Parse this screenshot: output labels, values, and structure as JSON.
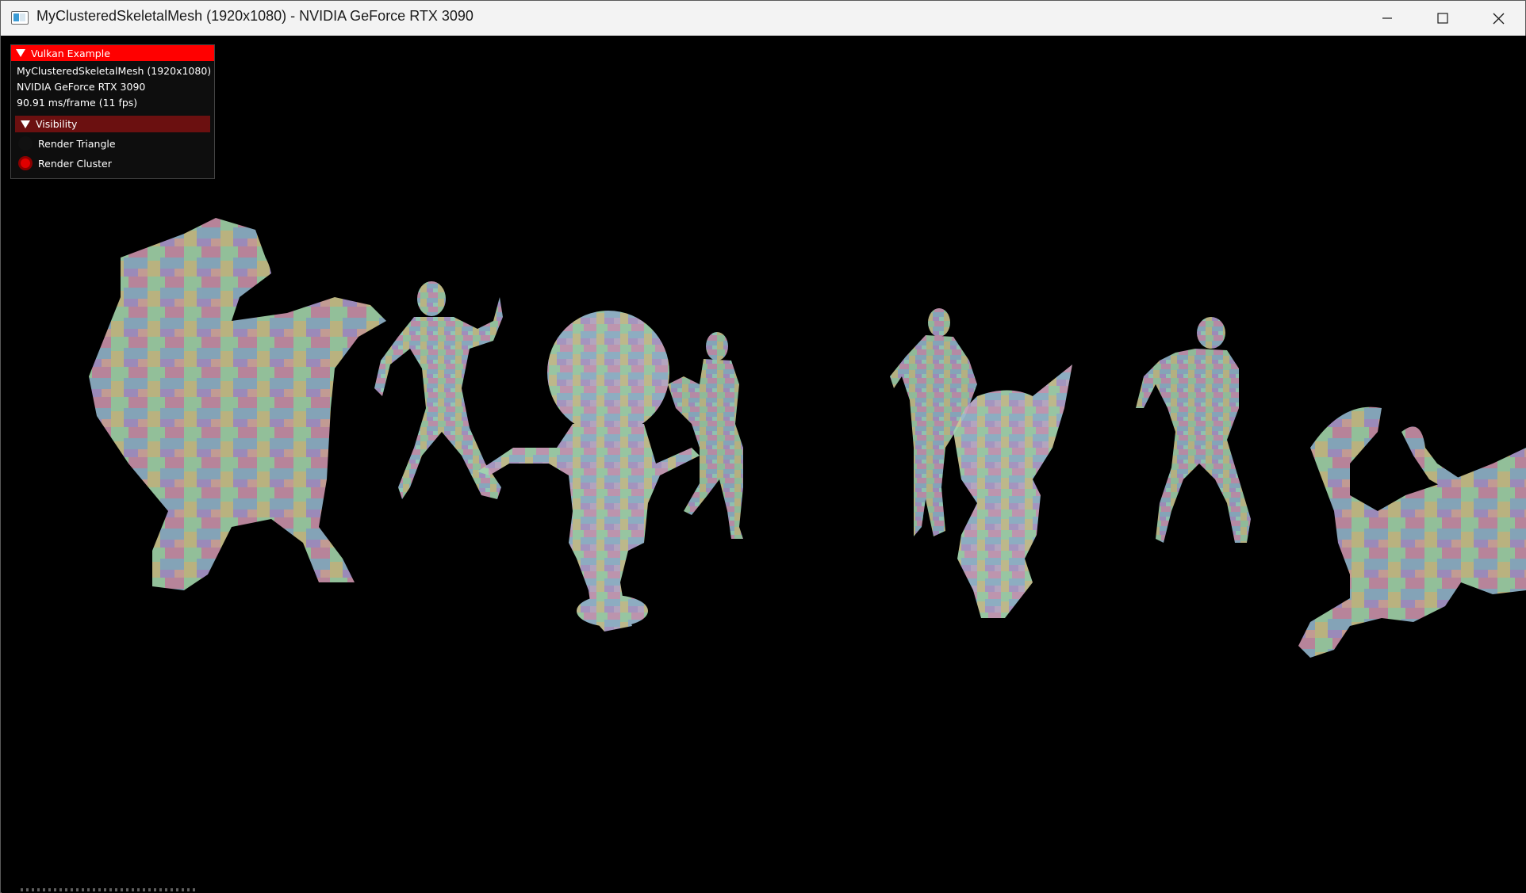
{
  "window": {
    "title": "MyClusteredSkeletalMesh (1920x1080) - NVIDIA GeForce RTX 3090",
    "minimize_icon": "minimize-icon",
    "maximize_icon": "maximize-icon",
    "close_icon": "close-icon"
  },
  "overlay": {
    "header": "Vulkan Example",
    "app_info": "MyClusteredSkeletalMesh (1920x1080)",
    "gpu": "NVIDIA GeForce RTX 3090",
    "frame_time": "90.91 ms/frame (11 fps)",
    "section": "Visibility",
    "options": [
      {
        "label": "Render Triangle",
        "selected": false
      },
      {
        "label": "Render Cluster",
        "selected": true
      }
    ]
  },
  "colors": {
    "overlay_header": "#ff0000",
    "section_header": "#6b1010",
    "radio_selected": "#e00000"
  }
}
